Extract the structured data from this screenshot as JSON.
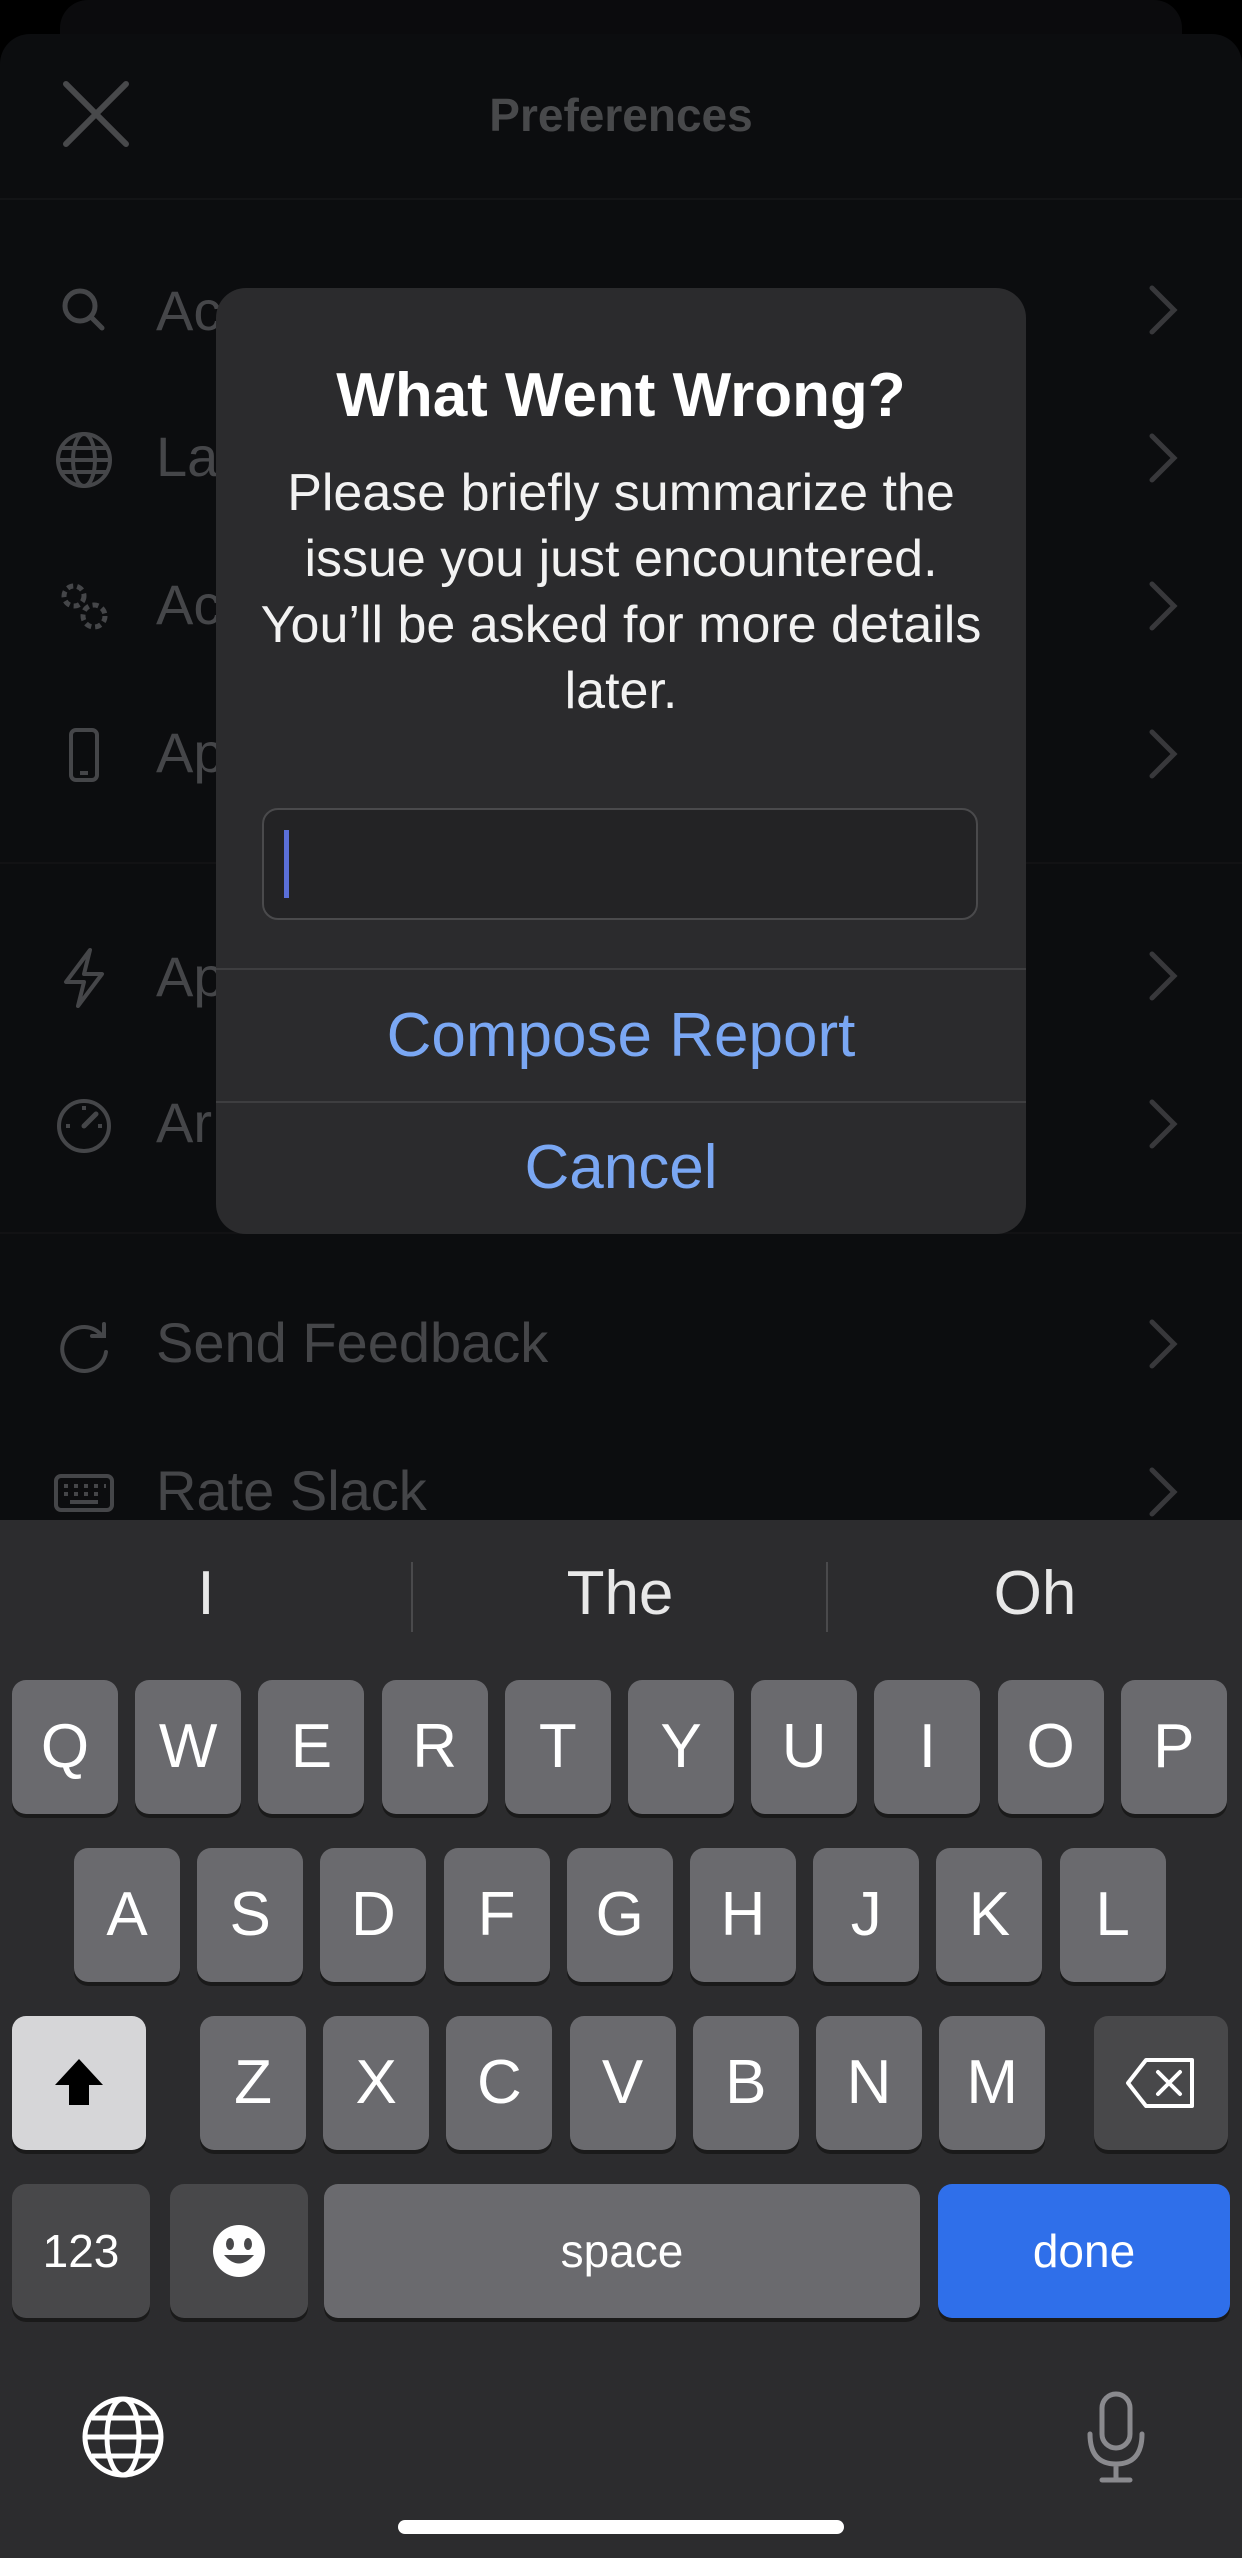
{
  "header": {
    "title": "Preferences"
  },
  "settings_rows": [
    {
      "label": "Ac",
      "icon": "search-icon"
    },
    {
      "label": "La",
      "icon": "globe-icon"
    },
    {
      "label": "Ac",
      "icon": "gears-icon"
    },
    {
      "label": "Ap",
      "icon": "phone-icon"
    },
    {
      "label": "Ap",
      "icon": "lightning-icon"
    },
    {
      "label": "Ar",
      "icon": "speedometer-icon"
    },
    {
      "label": "Send Feedback",
      "icon": "refresh-icon"
    },
    {
      "label": "Rate Slack",
      "icon": "keyboard-icon"
    }
  ],
  "alert": {
    "title": "What Went Wrong?",
    "message": "Please briefly summarize the issue you just encountered. You’ll be asked for more details later.",
    "input_value": "",
    "primary_button": "Compose Report",
    "cancel_button": "Cancel"
  },
  "keyboard": {
    "suggestions": [
      "I",
      "The",
      "Oh"
    ],
    "row1": [
      "Q",
      "W",
      "E",
      "R",
      "T",
      "Y",
      "U",
      "I",
      "O",
      "P"
    ],
    "row2": [
      "A",
      "S",
      "D",
      "F",
      "G",
      "H",
      "J",
      "K",
      "L"
    ],
    "row3": [
      "Z",
      "X",
      "C",
      "V",
      "B",
      "N",
      "M"
    ],
    "numbers_key": "123",
    "space_key": "space",
    "done_key": "done"
  },
  "colors": {
    "accent": "#7aa7f3",
    "done_key": "#2f6fea",
    "dialog_bg": "#2b2b2d"
  }
}
